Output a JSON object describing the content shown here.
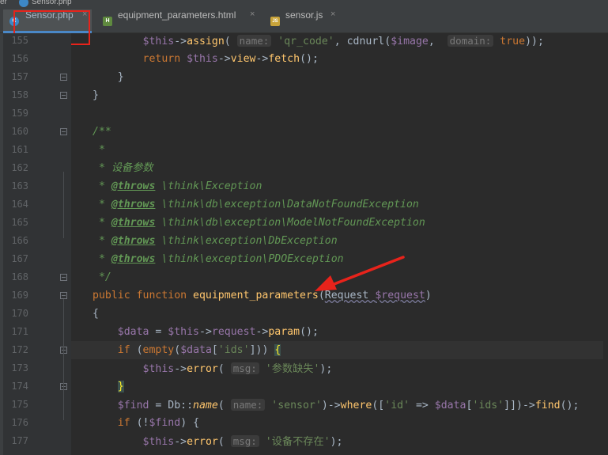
{
  "breadcrumb": {
    "left_text": "er",
    "file": "Sensor.php"
  },
  "tabs": [
    {
      "label": "Sensor.php",
      "icon": "php-class-icon",
      "icon_letter": "C",
      "active": true,
      "close": "×"
    },
    {
      "label": "equipment_parameters.html",
      "icon": "html-file-icon",
      "icon_letter": "H",
      "active": false,
      "close": "×"
    },
    {
      "label": "sensor.js",
      "icon": "js-file-icon",
      "icon_letter": "JS",
      "active": false,
      "close": "×"
    }
  ],
  "colors": {
    "annotation_red": "#e8231b",
    "keyword": "#cc7832",
    "function": "#ffc66d",
    "string": "#6a8759",
    "variable": "#9876aa",
    "doc_comment": "#629755",
    "tab_active_underline": "#4a88c7"
  },
  "lines": [
    {
      "num": "155",
      "segs": [
        [
          "plain",
          "        "
        ],
        [
          "var",
          "$this"
        ],
        [
          "plain",
          "->"
        ],
        [
          "fn",
          "assign"
        ],
        [
          "plain",
          "( "
        ],
        [
          "hint",
          "name:"
        ],
        [
          "plain",
          " "
        ],
        [
          "str",
          "'qr_code'"
        ],
        [
          "plain",
          ", cdnurl("
        ],
        [
          "var",
          "$image"
        ],
        [
          "plain",
          ",  "
        ],
        [
          "hint",
          "domain:"
        ],
        [
          "plain",
          " "
        ],
        [
          "kw",
          "true"
        ],
        [
          "plain",
          "));"
        ]
      ]
    },
    {
      "num": "156",
      "segs": [
        [
          "plain",
          "        "
        ],
        [
          "kw",
          "return "
        ],
        [
          "var",
          "$this"
        ],
        [
          "plain",
          "->"
        ],
        [
          "fn",
          "view"
        ],
        [
          "plain",
          "->"
        ],
        [
          "fn",
          "fetch"
        ],
        [
          "plain",
          "();"
        ]
      ]
    },
    {
      "num": "157",
      "segs": [
        [
          "plain",
          "    }"
        ]
      ]
    },
    {
      "num": "158",
      "segs": [
        [
          "plain",
          "}"
        ]
      ]
    },
    {
      "num": "159",
      "segs": [
        [
          "plain",
          ""
        ]
      ]
    },
    {
      "num": "160",
      "segs": [
        [
          "cm",
          "/**"
        ]
      ]
    },
    {
      "num": "161",
      "segs": [
        [
          "cm",
          " *"
        ]
      ]
    },
    {
      "num": "162",
      "segs": [
        [
          "cm",
          " * 设备参数"
        ]
      ]
    },
    {
      "num": "163",
      "segs": [
        [
          "cm",
          " * "
        ],
        [
          "tag",
          "@throws"
        ],
        [
          "cm",
          " \\think\\Exception"
        ]
      ]
    },
    {
      "num": "164",
      "segs": [
        [
          "cm",
          " * "
        ],
        [
          "tag",
          "@throws"
        ],
        [
          "cm",
          " \\think\\db\\exception\\DataNotFoundException"
        ]
      ]
    },
    {
      "num": "165",
      "segs": [
        [
          "cm",
          " * "
        ],
        [
          "tag",
          "@throws"
        ],
        [
          "cm",
          " \\think\\db\\exception\\ModelNotFoundException"
        ]
      ]
    },
    {
      "num": "166",
      "segs": [
        [
          "cm",
          " * "
        ],
        [
          "tag",
          "@throws"
        ],
        [
          "cm",
          " \\think\\exception\\DbException"
        ]
      ]
    },
    {
      "num": "167",
      "segs": [
        [
          "cm",
          " * "
        ],
        [
          "tag",
          "@throws"
        ],
        [
          "cm",
          " \\think\\exception\\PDOException"
        ]
      ]
    },
    {
      "num": "168",
      "segs": [
        [
          "cm",
          " */"
        ]
      ]
    },
    {
      "num": "169",
      "segs": [
        [
          "kw",
          "public function "
        ],
        [
          "fn",
          "equipment_parameters"
        ],
        [
          "plain",
          "("
        ],
        [
          "wavy",
          "Request "
        ],
        [
          "var wavy",
          "$request"
        ],
        [
          "plain",
          ")"
        ]
      ]
    },
    {
      "num": "170",
      "segs": [
        [
          "plain",
          "{"
        ]
      ]
    },
    {
      "num": "171",
      "segs": [
        [
          "plain",
          "    "
        ],
        [
          "var",
          "$data"
        ],
        [
          "plain",
          " = "
        ],
        [
          "var",
          "$this"
        ],
        [
          "plain",
          "->"
        ],
        [
          "var",
          "request"
        ],
        [
          "plain",
          "->"
        ],
        [
          "fn",
          "param"
        ],
        [
          "plain",
          "();"
        ]
      ]
    },
    {
      "num": "172",
      "segs": [
        [
          "plain",
          "    "
        ],
        [
          "kw",
          "if "
        ],
        [
          "plain",
          "("
        ],
        [
          "kw",
          "empty"
        ],
        [
          "plain",
          "("
        ],
        [
          "var",
          "$data"
        ],
        [
          "plain",
          "["
        ],
        [
          "str",
          "'ids'"
        ],
        [
          "plain",
          "])) "
        ],
        [
          "matched",
          "{"
        ]
      ]
    },
    {
      "num": "173",
      "segs": [
        [
          "plain",
          "        "
        ],
        [
          "var",
          "$this"
        ],
        [
          "plain",
          "->"
        ],
        [
          "fn",
          "error"
        ],
        [
          "plain",
          "( "
        ],
        [
          "hint",
          "msg:"
        ],
        [
          "plain",
          " "
        ],
        [
          "str",
          "'参数缺失'"
        ],
        [
          "plain",
          ");"
        ]
      ]
    },
    {
      "num": "174",
      "segs": [
        [
          "plain",
          "    "
        ],
        [
          "matched",
          "}"
        ]
      ]
    },
    {
      "num": "175",
      "segs": [
        [
          "plain",
          "    "
        ],
        [
          "var",
          "$find"
        ],
        [
          "plain",
          " = Db::"
        ],
        [
          "sfn",
          "name"
        ],
        [
          "plain",
          "( "
        ],
        [
          "hint",
          "name:"
        ],
        [
          "plain",
          " "
        ],
        [
          "str",
          "'sensor'"
        ],
        [
          "plain",
          ")->"
        ],
        [
          "fn",
          "where"
        ],
        [
          "plain",
          "(["
        ],
        [
          "str",
          "'id'"
        ],
        [
          "plain",
          " => "
        ],
        [
          "var",
          "$data"
        ],
        [
          "plain",
          "["
        ],
        [
          "str",
          "'ids'"
        ],
        [
          "plain",
          "]])->"
        ],
        [
          "fn",
          "find"
        ],
        [
          "plain",
          "();"
        ]
      ]
    },
    {
      "num": "176",
      "segs": [
        [
          "plain",
          "    "
        ],
        [
          "kw",
          "if "
        ],
        [
          "plain",
          "(!"
        ],
        [
          "var",
          "$find"
        ],
        [
          "plain",
          ") {"
        ]
      ]
    },
    {
      "num": "177",
      "segs": [
        [
          "plain",
          "        "
        ],
        [
          "var",
          "$this"
        ],
        [
          "plain",
          "->"
        ],
        [
          "fn",
          "error"
        ],
        [
          "plain",
          "( "
        ],
        [
          "hint",
          "msg:"
        ],
        [
          "plain",
          " "
        ],
        [
          "str",
          "'设备不存在'"
        ],
        [
          "plain",
          ");"
        ]
      ]
    }
  ],
  "arrow": {
    "color": "#e8231b",
    "points_to": "equipment_parameters"
  }
}
